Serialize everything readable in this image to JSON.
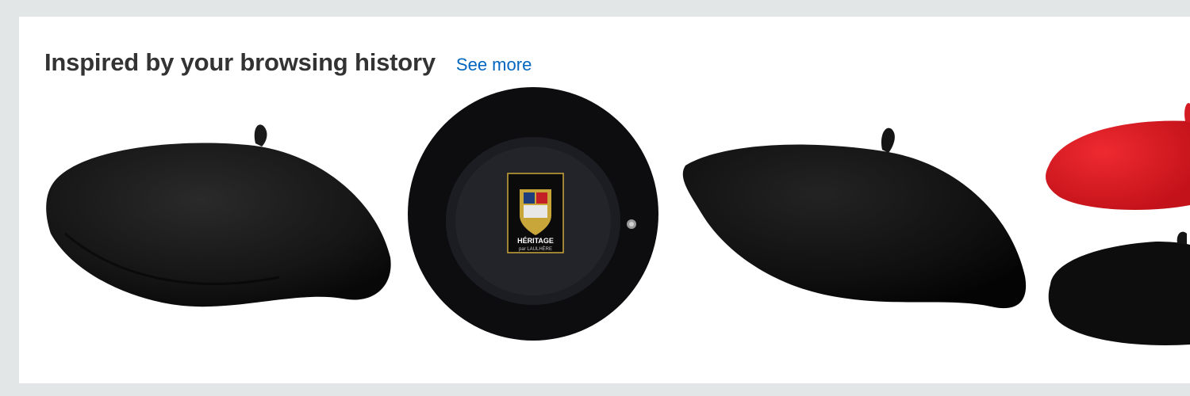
{
  "section": {
    "title": "Inspired by your browsing history",
    "see_more_label": "See more"
  },
  "products": [
    {
      "icon": "black-beret-side-view-image",
      "color": "#141414"
    },
    {
      "icon": "black-beret-inside-view-image",
      "color": "#0d0d10",
      "label_text": "HÉRITAGE",
      "label_subtext": "par LAULHÈRE"
    },
    {
      "icon": "black-beret-angled-view-image",
      "color": "#0a0a0a"
    },
    {
      "icon": "red-and-black-berets-image",
      "colors": [
        "#e01a22",
        "#0d0d0d"
      ]
    }
  ]
}
